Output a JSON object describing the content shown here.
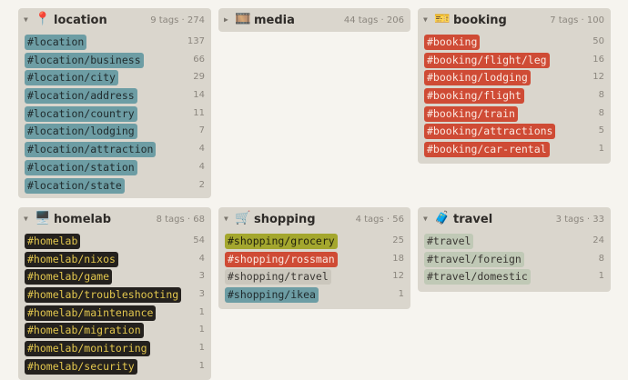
{
  "cards": {
    "location": {
      "title": "location",
      "meta": "9 tags · 274",
      "icon": "round-pushpin-icon",
      "emoji": "📍",
      "tags": [
        {
          "label": "#location",
          "count": "137",
          "style": "teal"
        },
        {
          "label": "#location/business",
          "count": "66",
          "style": "teal"
        },
        {
          "label": "#location/city",
          "count": "29",
          "style": "teal"
        },
        {
          "label": "#location/address",
          "count": "14",
          "style": "teal"
        },
        {
          "label": "#location/country",
          "count": "11",
          "style": "teal"
        },
        {
          "label": "#location/lodging",
          "count": "7",
          "style": "teal"
        },
        {
          "label": "#location/attraction",
          "count": "4",
          "style": "teal"
        },
        {
          "label": "#location/station",
          "count": "4",
          "style": "teal"
        },
        {
          "label": "#location/state",
          "count": "2",
          "style": "teal"
        }
      ]
    },
    "media": {
      "title": "media",
      "meta": "44 tags · 206",
      "icon": "film-frames-icon",
      "emoji": "🎞️",
      "tags": []
    },
    "booking": {
      "title": "booking",
      "meta": "7 tags · 100",
      "icon": "ticket-icon",
      "emoji": "🎫",
      "tags": [
        {
          "label": "#booking",
          "count": "50",
          "style": "red"
        },
        {
          "label": "#booking/flight/leg",
          "count": "16",
          "style": "red"
        },
        {
          "label": "#booking/lodging",
          "count": "12",
          "style": "red"
        },
        {
          "label": "#booking/flight",
          "count": "8",
          "style": "red"
        },
        {
          "label": "#booking/train",
          "count": "8",
          "style": "red"
        },
        {
          "label": "#booking/attractions",
          "count": "5",
          "style": "red"
        },
        {
          "label": "#booking/car-rental",
          "count": "1",
          "style": "red"
        }
      ]
    },
    "homelab": {
      "title": "homelab",
      "meta": "8 tags · 68",
      "icon": "desktop-computer-icon",
      "emoji": "🖥️",
      "tags": [
        {
          "label": "#homelab",
          "count": "54",
          "style": "dark"
        },
        {
          "label": "#homelab/nixos",
          "count": "4",
          "style": "dark"
        },
        {
          "label": "#homelab/game",
          "count": "3",
          "style": "dark"
        },
        {
          "label": "#homelab/troubleshooting",
          "count": "3",
          "style": "dark"
        },
        {
          "label": "#homelab/maintenance",
          "count": "1",
          "style": "dark"
        },
        {
          "label": "#homelab/migration",
          "count": "1",
          "style": "dark"
        },
        {
          "label": "#homelab/monitoring",
          "count": "1",
          "style": "dark"
        },
        {
          "label": "#homelab/security",
          "count": "1",
          "style": "dark"
        }
      ]
    },
    "shopping": {
      "title": "shopping",
      "meta": "4 tags · 56",
      "icon": "shopping-cart-icon",
      "emoji": "🛒",
      "tags": [
        {
          "label": "#shopping/grocery",
          "count": "25",
          "style": "olive"
        },
        {
          "label": "#shopping/rossman",
          "count": "18",
          "style": "red"
        },
        {
          "label": "#shopping/travel",
          "count": "12",
          "style": "light"
        },
        {
          "label": "#shopping/ikea",
          "count": "1",
          "style": "teal"
        }
      ]
    },
    "travel": {
      "title": "travel",
      "meta": "3 tags · 33",
      "icon": "luggage-icon",
      "emoji": "🧳",
      "tags": [
        {
          "label": "#travel",
          "count": "24",
          "style": "sage"
        },
        {
          "label": "#travel/foreign",
          "count": "8",
          "style": "sage"
        },
        {
          "label": "#travel/domestic",
          "count": "1",
          "style": "sage"
        }
      ]
    }
  },
  "colors": {
    "teal": "#6d9da4",
    "red": "#cf4b35",
    "dark": "#24211e",
    "olive": "#a4a72e",
    "light": "#cbc7bd",
    "sage": "#c0c9b6",
    "card_bg": "#dad6cd",
    "page_bg": "#f6f4ef"
  }
}
